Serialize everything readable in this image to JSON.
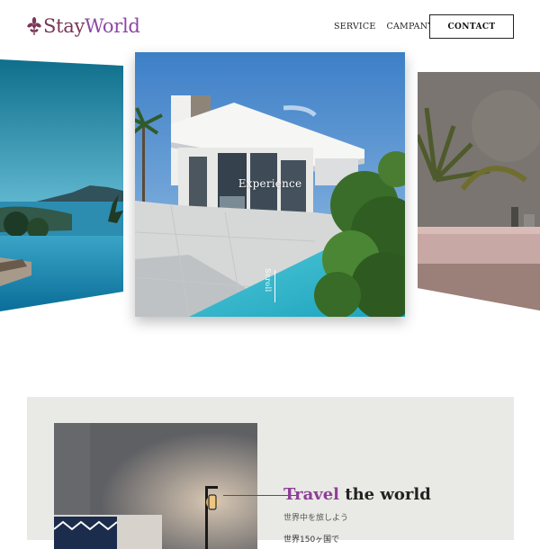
{
  "brand": {
    "part1": "Stay",
    "part2": "World",
    "color_stay": "#7a3557",
    "color_world": "#8d47a3",
    "icon": "fleur-ornament-icon"
  },
  "nav": {
    "items": [
      "SERVICE",
      "CAMPANY"
    ],
    "contact_label": "CONTACT"
  },
  "hero": {
    "center_label": "Experience",
    "scroll_label": "Scroll",
    "slides": [
      {
        "name": "seaside-pool-photo"
      },
      {
        "name": "modern-villa-pool-photo"
      },
      {
        "name": "bathtub-plant-photo"
      }
    ]
  },
  "feature": {
    "title_highlight": "Travel",
    "title_rest": " the world",
    "subtitle": "世界中を旅しよう",
    "detail": "世界150ヶ国で",
    "accent_color": "#8d3f96",
    "photo": "bedroom-lamp-photo"
  }
}
